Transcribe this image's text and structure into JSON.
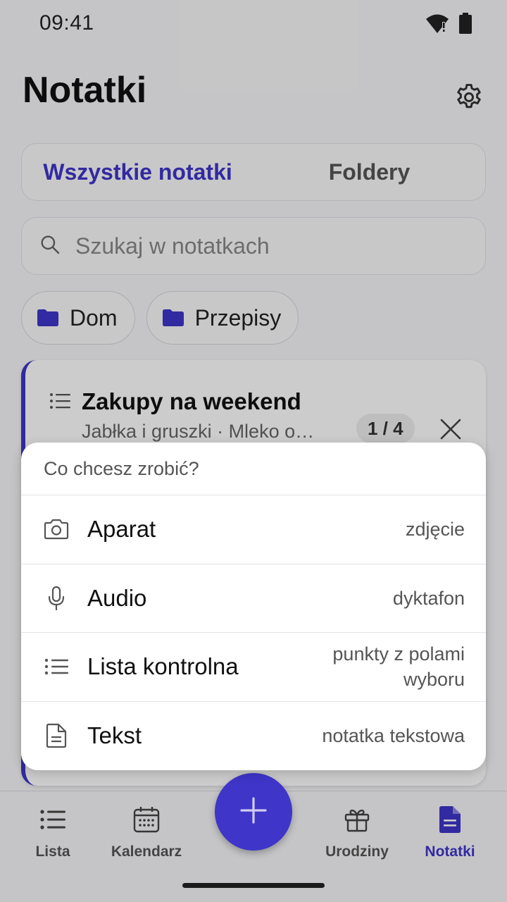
{
  "status_bar": {
    "time": "09:41"
  },
  "header": {
    "title": "Notatki"
  },
  "tabs": [
    {
      "label": "Wszystkie notatki",
      "active": true
    },
    {
      "label": "Foldery",
      "active": false
    }
  ],
  "search": {
    "placeholder": "Szukaj w notatkach",
    "value": ""
  },
  "folders": [
    {
      "label": "Dom"
    },
    {
      "label": "Przepisy"
    }
  ],
  "note": {
    "title": "Zakupy na weekend",
    "preview": "Jabłka i gruszki · Mleko o…",
    "progress": "1 / 4"
  },
  "popup": {
    "header": "Co chcesz zrobić?",
    "items": [
      {
        "icon": "camera-icon",
        "label": "Aparat",
        "description": "zdjęcie"
      },
      {
        "icon": "microphone-icon",
        "label": "Audio",
        "description": "dyktafon"
      },
      {
        "icon": "checklist-icon",
        "label": "Lista kontrolna",
        "description": "punkty z polami wyboru"
      },
      {
        "icon": "document-icon",
        "label": "Tekst",
        "description": "notatka tekstowa"
      }
    ]
  },
  "bottom_nav": [
    {
      "label": "Lista",
      "icon": "list-icon",
      "active": false
    },
    {
      "label": "Kalendarz",
      "icon": "calendar-icon",
      "active": false
    },
    {
      "label": "Urodziny",
      "icon": "gift-icon",
      "active": false
    },
    {
      "label": "Notatki",
      "icon": "note-icon",
      "active": true
    }
  ],
  "colors": {
    "accent": "#3f35c8",
    "background": "#f7f7f9"
  }
}
